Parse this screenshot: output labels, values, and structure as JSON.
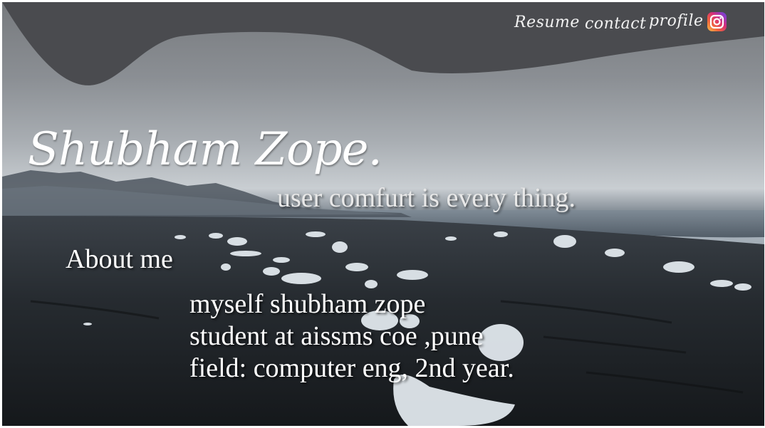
{
  "nav": {
    "resume_label": "Resume",
    "contact_label": "contact",
    "profile_label": "profile",
    "instagram_icon": "instagram-icon"
  },
  "hero": {
    "name": "Shubham Zope.",
    "tagline": "user comfurt is every thing."
  },
  "about": {
    "title": "About me",
    "lines": [
      "myself shubham zope",
      "student at aissms coe ,pune",
      "field: computer eng, 2nd year."
    ]
  },
  "colors": {
    "text": "#ffffff",
    "header_shape": "#4a4b4f"
  }
}
